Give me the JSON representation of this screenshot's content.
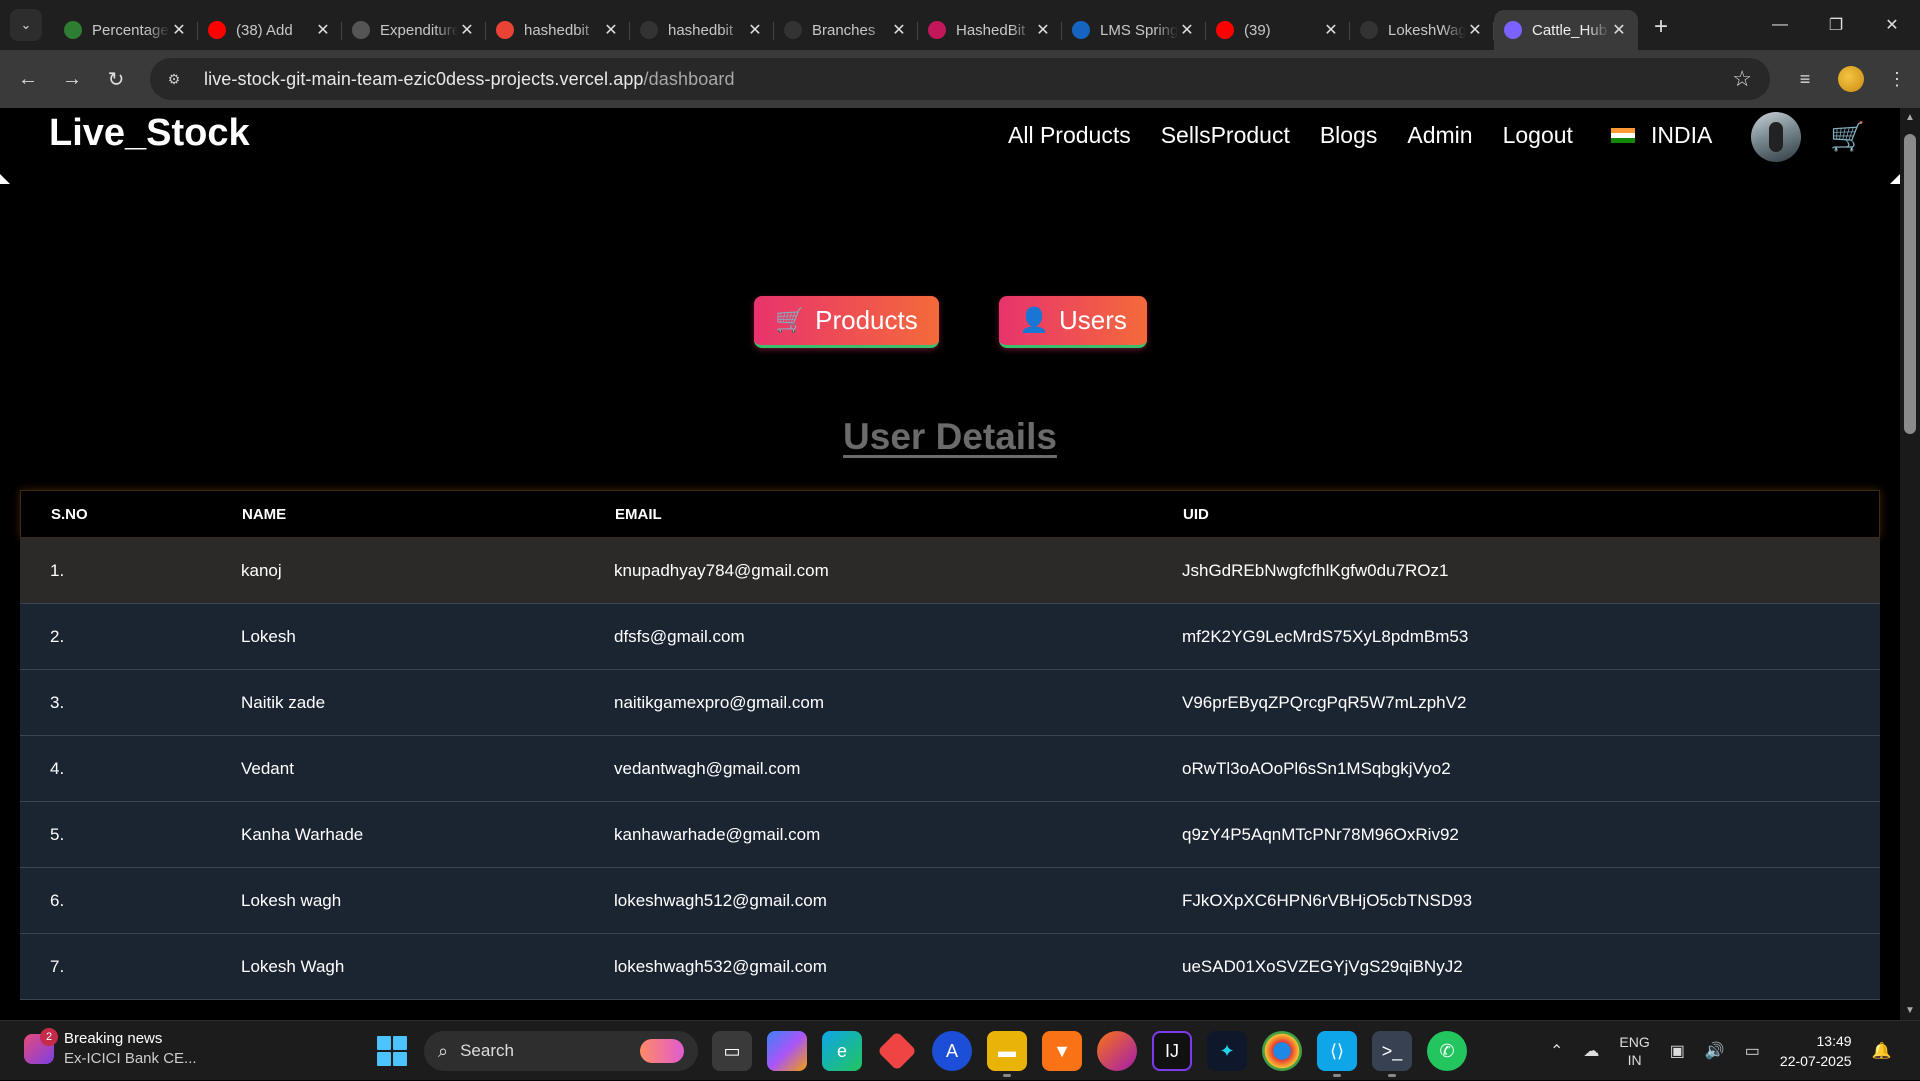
{
  "browser": {
    "tabs": [
      {
        "title": "Percentage",
        "favicon": "percent-icon",
        "color": "#2e7d32"
      },
      {
        "title": "(38) Add",
        "favicon": "youtube-icon",
        "color": "#ff0000"
      },
      {
        "title": "Expenditure",
        "favicon": "openai-icon",
        "color": "#555555"
      },
      {
        "title": "hashedbit",
        "favicon": "gmail-icon",
        "color": "#ea4335"
      },
      {
        "title": "hashedbit",
        "favicon": "github-icon",
        "color": "#333333"
      },
      {
        "title": "Branches",
        "favicon": "github-icon",
        "color": "#333333"
      },
      {
        "title": "HashedBit",
        "favicon": "hashedbit-icon",
        "color": "#c2185b"
      },
      {
        "title": "LMS Spring",
        "favicon": "lms-icon",
        "color": "#1565c0"
      },
      {
        "title": "(39)",
        "favicon": "youtube-icon",
        "color": "#ff0000"
      },
      {
        "title": "LokeshWagh",
        "favicon": "github-icon",
        "color": "#333333"
      },
      {
        "title": "Cattle_Hub",
        "favicon": "vite-icon",
        "color": "#7b61ff",
        "active": true
      }
    ],
    "url_host": "live-stock-git-main-team-ezic0dess-projects.vercel.app",
    "url_path": "/dashboard"
  },
  "navbar": {
    "brand": "Live_Stock",
    "links": [
      "All Products",
      "SellsProduct",
      "Blogs",
      "Admin",
      "Logout"
    ],
    "country": "INDIA"
  },
  "buttons": {
    "products": "Products",
    "users": "Users"
  },
  "section_title": "User Details",
  "table": {
    "headers": [
      "S.NO",
      "NAME",
      "EMAIL",
      "UID"
    ],
    "rows": [
      [
        "1.",
        "kanoj",
        "knupadhyay784@gmail.com",
        "JshGdREbNwgfcfhlKgfw0du7ROz1"
      ],
      [
        "2.",
        "Lokesh",
        "dfsfs@gmail.com",
        "mf2K2YG9LecMrdS75XyL8pdmBm53"
      ],
      [
        "3.",
        "Naitik zade",
        "naitikgamexpro@gmail.com",
        "V96prEByqZPQrcgPqR5W7mLzphV2"
      ],
      [
        "4.",
        "Vedant",
        "vedantwagh@gmail.com",
        "oRwTl3oAOoPl6sSn1MSqbgkjVyo2"
      ],
      [
        "5.",
        "Kanha Warhade",
        "kanhawarhade@gmail.com",
        "q9zY4P5AqnMTcPNr78M96OxRiv92"
      ],
      [
        "6.",
        "Lokesh wagh",
        "lokeshwagh512@gmail.com",
        "FJkOXpXC6HPN6rVBHjO5cbTNSD93"
      ],
      [
        "7.",
        "Lokesh Wagh",
        "lokeshwagh532@gmail.com",
        "ueSAD01XoSVZEGYjVgS29qiBNyJ2"
      ]
    ]
  },
  "taskbar": {
    "news_title": "Breaking news",
    "news_sub": "Ex-ICICI Bank CE...",
    "news_badge": "2",
    "search": "Search",
    "lang_top": "ENG",
    "lang_bottom": "IN",
    "time": "13:49",
    "date": "22-07-2025"
  }
}
